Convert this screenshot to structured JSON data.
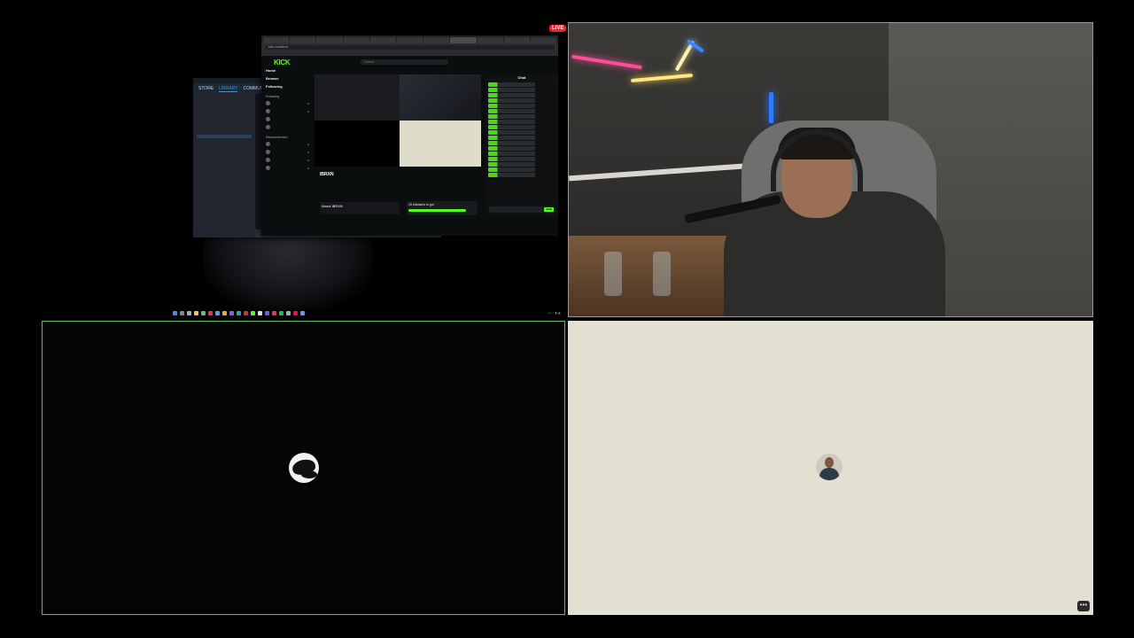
{
  "screen_share": {
    "live_badge": "LIVE",
    "steam": {
      "nav": [
        "STORE",
        "LIBRARY",
        "COMMUNITY"
      ]
    },
    "browser": {
      "url": "kick.com/ibrxn",
      "site_logo": "KICK",
      "search_placeholder": "Search",
      "nav": [
        "Home",
        "Browse",
        "Following"
      ],
      "sections": [
        "Following",
        "Recommended"
      ],
      "streamer_name": "IBRXN",
      "followers_title": "15 followers to go!",
      "about_label": "About IBRXN",
      "chat_title": "Chat",
      "chat_send": "Chat"
    }
  },
  "colors": {
    "tile_border": "#5fbf6a",
    "kick_green": "#53fc18",
    "beige_tile": "#e3dfd1",
    "live_red": "#e8262b"
  },
  "tiles": {
    "screen": "shared-screen",
    "camera": "webcam",
    "black": "participant-avatar-tile",
    "beige": "participant-avatar-tile"
  },
  "controls": {
    "more_label": "•••"
  },
  "icons": [
    "live-badge-icon",
    "more-options-icon",
    "avatar-icon"
  ]
}
